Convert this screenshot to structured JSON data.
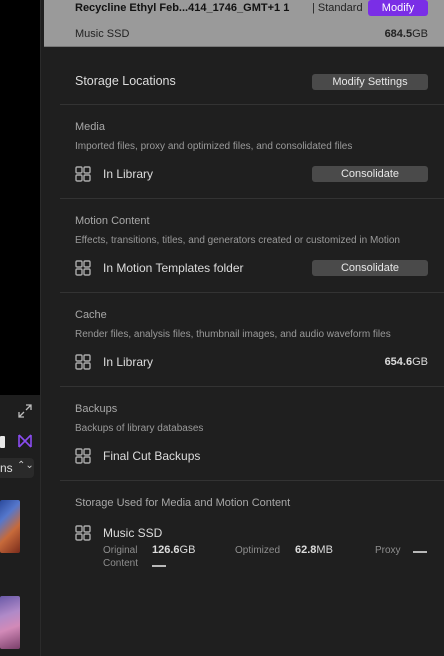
{
  "left_panel": {
    "popup_text": "ns",
    "popup_chevron": "⌃⌄"
  },
  "header": {
    "library_name": "Recycline Ethyl Feb...414_1746_GMT+1 1",
    "library_type": "| Standard",
    "modify_label": "Modify",
    "disk_name": "Music SSD",
    "disk_size_number": "684.5",
    "disk_size_unit": "GB"
  },
  "storage_locations": {
    "title": "Storage Locations",
    "modify_settings_label": "Modify Settings"
  },
  "sections": {
    "media": {
      "title": "Media",
      "description": "Imported files, proxy and optimized files, and consolidated files",
      "location": "In Library",
      "button": "Consolidate"
    },
    "motion": {
      "title": "Motion Content",
      "description": "Effects, transitions, titles, and generators created or customized in Motion",
      "location": "In Motion Templates folder",
      "button": "Consolidate"
    },
    "cache": {
      "title": "Cache",
      "description": "Render files, analysis files, thumbnail images, and audio waveform files",
      "location": "In Library",
      "size_number": "654.6",
      "size_unit": "GB"
    },
    "backups": {
      "title": "Backups",
      "description": "Backups of library databases",
      "location": "Final Cut Backups"
    }
  },
  "storage_used": {
    "title": "Storage Used for Media and Motion Content",
    "disk_name": "Music SSD",
    "original_label": "Original",
    "content_label": "Content",
    "original_number": "126.6",
    "original_unit": "GB",
    "optimized_label": "Optimized",
    "optimized_number": "62.8",
    "optimized_unit": "MB",
    "proxy_label": "Proxy"
  },
  "colors": {
    "accent": "#7a2ee6",
    "panel_bg": "#1f1f1f",
    "header_bg": "#9a9a9a",
    "button_bg": "#4a4a4a"
  },
  "icons": [
    "expand-icon",
    "view-mode-icon",
    "bowtie-icon",
    "location-grid-icon"
  ]
}
